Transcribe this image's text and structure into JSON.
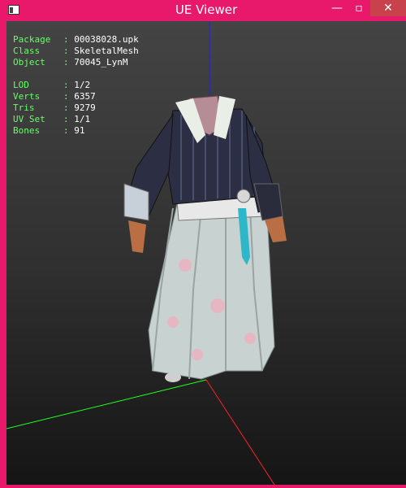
{
  "window": {
    "title": "UE Viewer",
    "minimize_label": "—",
    "maximize_label": "▫",
    "close_label": "✕"
  },
  "info": [
    {
      "key": "Package",
      "value": "00038028.upk"
    },
    {
      "key": "Class  ",
      "value": "SkeletalMesh"
    },
    {
      "key": "Object ",
      "value": "70045_LynM"
    },
    {
      "key": "LOD    ",
      "value": "1/2"
    },
    {
      "key": "Verts  ",
      "value": "6357"
    },
    {
      "key": "Tris   ",
      "value": "9279"
    },
    {
      "key": "UV Set ",
      "value": "1/1"
    },
    {
      "key": "Bones  ",
      "value": "91"
    }
  ],
  "colors": {
    "frame": "#e8186a",
    "close": "#c7424b",
    "label": "#66ff66",
    "axis_x": "#ff2020",
    "axis_y": "#20ff20",
    "axis_z": "#2020ff"
  }
}
